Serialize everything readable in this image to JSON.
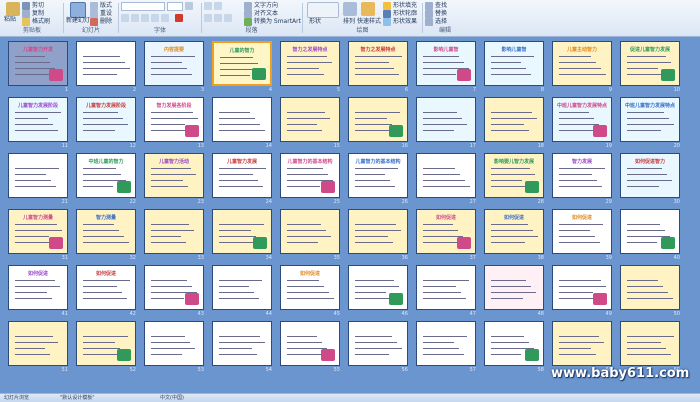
{
  "ribbon": {
    "clipboard": {
      "paste": "粘贴",
      "cut": "剪切",
      "copy": "复制",
      "format_painter": "格式刷",
      "label": "剪贴板"
    },
    "slides": {
      "new_slide": "新建幻灯片",
      "layout": "版式",
      "reset": "重设",
      "delete": "删除",
      "label": "幻灯片"
    },
    "font": {
      "name": "",
      "size": "",
      "label": "字体"
    },
    "paragraph": {
      "text_direction": "文字方向",
      "align_text": "对齐文本",
      "smartart": "转换为 SmartArt",
      "label": "段落"
    },
    "drawing": {
      "shapes": "形状",
      "arrange": "排列",
      "quick_styles": "快速样式",
      "fill": "形状填充",
      "outline": "形状轮廓",
      "effects": "形状效果",
      "label": "绘图"
    },
    "editing": {
      "find": "查找",
      "replace": "替换",
      "select": "选择",
      "label": "编辑"
    }
  },
  "slides": [
    {
      "n": 1,
      "title": "儿童智力开发",
      "bg": "#8fa0c9"
    },
    {
      "n": 2,
      "title": "",
      "bg": "#ffffff"
    },
    {
      "n": 3,
      "title": "内容提要",
      "bg": "#eaf6ff"
    },
    {
      "n": 4,
      "title": "儿童的智力",
      "bg": "#fff6c8"
    },
    {
      "n": 5,
      "title": "智力之发展特点",
      "bg": "#fff3c4"
    },
    {
      "n": 6,
      "title": "智力之发展特点",
      "bg": "#fff3c4"
    },
    {
      "n": 7,
      "title": "影响儿童智",
      "bg": "#e9f7ff"
    },
    {
      "n": 8,
      "title": "影响儿童智",
      "bg": "#e9f7ff"
    },
    {
      "n": 9,
      "title": "儿童主动智力",
      "bg": "#fff3c4"
    },
    {
      "n": 10,
      "title": "促进儿童智力发展",
      "bg": "#fff3c4"
    },
    {
      "n": 11,
      "title": "儿童智力发展阶段",
      "bg": "#e9f7ff"
    },
    {
      "n": 12,
      "title": "儿童智力发展阶段",
      "bg": "#e9f7ff"
    },
    {
      "n": 13,
      "title": "智力发展各阶段",
      "bg": "#ffffff"
    },
    {
      "n": 14,
      "title": "",
      "bg": "#ffffff"
    },
    {
      "n": 15,
      "title": "",
      "bg": "#fff3c4"
    },
    {
      "n": 16,
      "title": "",
      "bg": "#fff3c4"
    },
    {
      "n": 17,
      "title": "",
      "bg": "#e9f7ff"
    },
    {
      "n": 18,
      "title": "",
      "bg": "#fff3c4"
    },
    {
      "n": 19,
      "title": "中班儿童智力发展特点",
      "bg": "#e9f7ff"
    },
    {
      "n": 20,
      "title": "中班儿童智力发展特点",
      "bg": "#e9f7ff"
    },
    {
      "n": 21,
      "title": "",
      "bg": "#ffffff"
    },
    {
      "n": 22,
      "title": "中班儿童的智力",
      "bg": "#ffffff"
    },
    {
      "n": 23,
      "title": "儿童智力活动",
      "bg": "#fff3c4"
    },
    {
      "n": 24,
      "title": "儿童智力发展",
      "bg": "#ffffff"
    },
    {
      "n": 25,
      "title": "儿童智力的基本结构",
      "bg": "#ffffff"
    },
    {
      "n": 26,
      "title": "儿童智力的基本结构",
      "bg": "#ffffff"
    },
    {
      "n": 27,
      "title": "",
      "bg": "#ffffff"
    },
    {
      "n": 28,
      "title": "影响婴儿智力发展",
      "bg": "#fff3c4"
    },
    {
      "n": 29,
      "title": "智力发展",
      "bg": "#ffffff"
    },
    {
      "n": 30,
      "title": "如何促进智力",
      "bg": "#e9f7ff"
    },
    {
      "n": 31,
      "title": "儿童智力测量",
      "bg": "#fff3c4"
    },
    {
      "n": 32,
      "title": "智力测量",
      "bg": "#fff3c4"
    },
    {
      "n": 33,
      "title": "",
      "bg": "#fff3c4"
    },
    {
      "n": 34,
      "title": "",
      "bg": "#fff3c4"
    },
    {
      "n": 35,
      "title": "",
      "bg": "#fff3c4"
    },
    {
      "n": 36,
      "title": "",
      "bg": "#fff3c4"
    },
    {
      "n": 37,
      "title": "如何促进",
      "bg": "#fff3c4"
    },
    {
      "n": 38,
      "title": "如何促进",
      "bg": "#fff3c4"
    },
    {
      "n": 39,
      "title": "如何促进",
      "bg": "#ffffff"
    },
    {
      "n": 40,
      "title": "",
      "bg": "#ffffff"
    },
    {
      "n": 41,
      "title": "如何促进",
      "bg": "#ffffff"
    },
    {
      "n": 42,
      "title": "如何促进",
      "bg": "#ffffff"
    },
    {
      "n": 43,
      "title": "",
      "bg": "#ffffff"
    },
    {
      "n": 44,
      "title": "",
      "bg": "#ffffff"
    },
    {
      "n": 45,
      "title": "如何促进",
      "bg": "#ffffff"
    },
    {
      "n": 46,
      "title": "",
      "bg": "#ffffff"
    },
    {
      "n": 47,
      "title": "",
      "bg": "#ffffff"
    },
    {
      "n": 48,
      "title": "",
      "bg": "#fff0f5"
    },
    {
      "n": 49,
      "title": "",
      "bg": "#ffffff"
    },
    {
      "n": 50,
      "title": "",
      "bg": "#fff3c4"
    },
    {
      "n": 51,
      "title": "",
      "bg": "#fff3c4"
    },
    {
      "n": 52,
      "title": "",
      "bg": "#fff3c4"
    },
    {
      "n": 53,
      "title": "",
      "bg": "#ffffff"
    },
    {
      "n": 54,
      "title": "",
      "bg": "#ffffff"
    },
    {
      "n": 55,
      "title": "",
      "bg": "#ffffff"
    },
    {
      "n": 56,
      "title": "",
      "bg": "#ffffff"
    },
    {
      "n": 57,
      "title": "",
      "bg": "#ffffff"
    },
    {
      "n": 58,
      "title": "",
      "bg": "#ffffff"
    },
    {
      "n": 59,
      "title": "",
      "bg": "#fff3c4"
    },
    {
      "n": 60,
      "title": "",
      "bg": "#fff3c4"
    },
    {
      "n": 61,
      "title": "",
      "bg": "#ffffff"
    },
    {
      "n": 62,
      "title": "",
      "bg": "#fff3c4"
    }
  ],
  "status": {
    "view": "幻灯片浏览",
    "theme": "\"默认设计模板\"",
    "lang": "中文(中国)"
  },
  "watermark": "www.baby611.com",
  "colors": {
    "ribbon": "#dbe6f4",
    "sorter_bg": "#6b95cf",
    "border": "#2a4b7c"
  }
}
